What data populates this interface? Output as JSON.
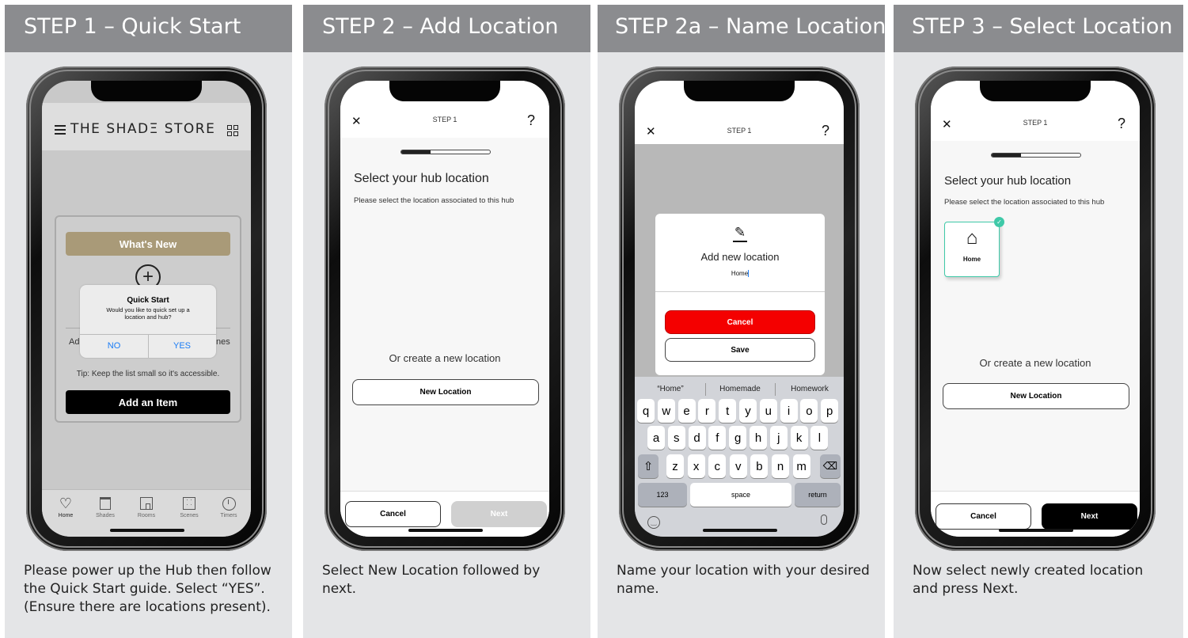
{
  "panels": [
    {
      "title": "STEP 1 – Quick Start",
      "caption": "Please power up the Hub then follow the Quick Start guide. Select “YES”. (Ensure there are locations present).",
      "screen": {
        "brand": "THE SHADΞ STORE",
        "whats_new": "What's New",
        "dialog_title": "Quick Start",
        "dialog_text": "Would you like to quick set up a location and hub?",
        "no_label": "NO",
        "yes_label": "YES",
        "side_left": "Add",
        "side_right": "nes",
        "tip": "Tip: Keep the list small so it's accessible.",
        "add_item": "Add an Item",
        "tabs": [
          "Home",
          "Shades",
          "Rooms",
          "Scenes",
          "Timers"
        ]
      }
    },
    {
      "title": "STEP 2 – Add Location",
      "caption": "Select New Location followed by next.",
      "screen": {
        "close": "✕",
        "step": "STEP 1",
        "help": "?",
        "heading": "Select your hub location",
        "sub": "Please select the location associated to this hub",
        "or_create": "Or create a new location",
        "new_location": "New Location",
        "cancel": "Cancel",
        "next": "Next",
        "progress": 0.33
      }
    },
    {
      "title": "STEP 2a – Name Location",
      "caption": "Name your location with your desired name.",
      "screen": {
        "close": "✕",
        "step": "STEP 1",
        "help": "?",
        "modal_title": "Add new location",
        "input_value": "Home",
        "cancel": "Cancel",
        "save": "Save",
        "suggestions": [
          "“Home”",
          "Homemade",
          "Homework"
        ],
        "row1": [
          "q",
          "w",
          "e",
          "r",
          "t",
          "y",
          "u",
          "i",
          "o",
          "p"
        ],
        "row2": [
          "a",
          "s",
          "d",
          "f",
          "g",
          "h",
          "j",
          "k",
          "l"
        ],
        "row3": [
          "z",
          "x",
          "c",
          "v",
          "b",
          "n",
          "m"
        ],
        "numbers": "123",
        "space": "space",
        "return": "return"
      }
    },
    {
      "title": "STEP 3 – Select Location",
      "caption": "Now select newly created location and press Next.",
      "screen": {
        "close": "✕",
        "step": "STEP 1",
        "help": "?",
        "heading": "Select your hub location",
        "sub": "Please select the location associated to this hub",
        "tile_label": "Home",
        "or_create": "Or create a new location",
        "new_location": "New Location",
        "cancel": "Cancel",
        "next": "Next",
        "progress": 0.33
      }
    }
  ],
  "colors": {
    "header": "#8b8c8f",
    "panel_bg": "#e4e5e7",
    "gold": "#a99a78",
    "ios_blue": "#1a7cf5",
    "red": "#f40000",
    "teal": "#3fc9a8"
  }
}
